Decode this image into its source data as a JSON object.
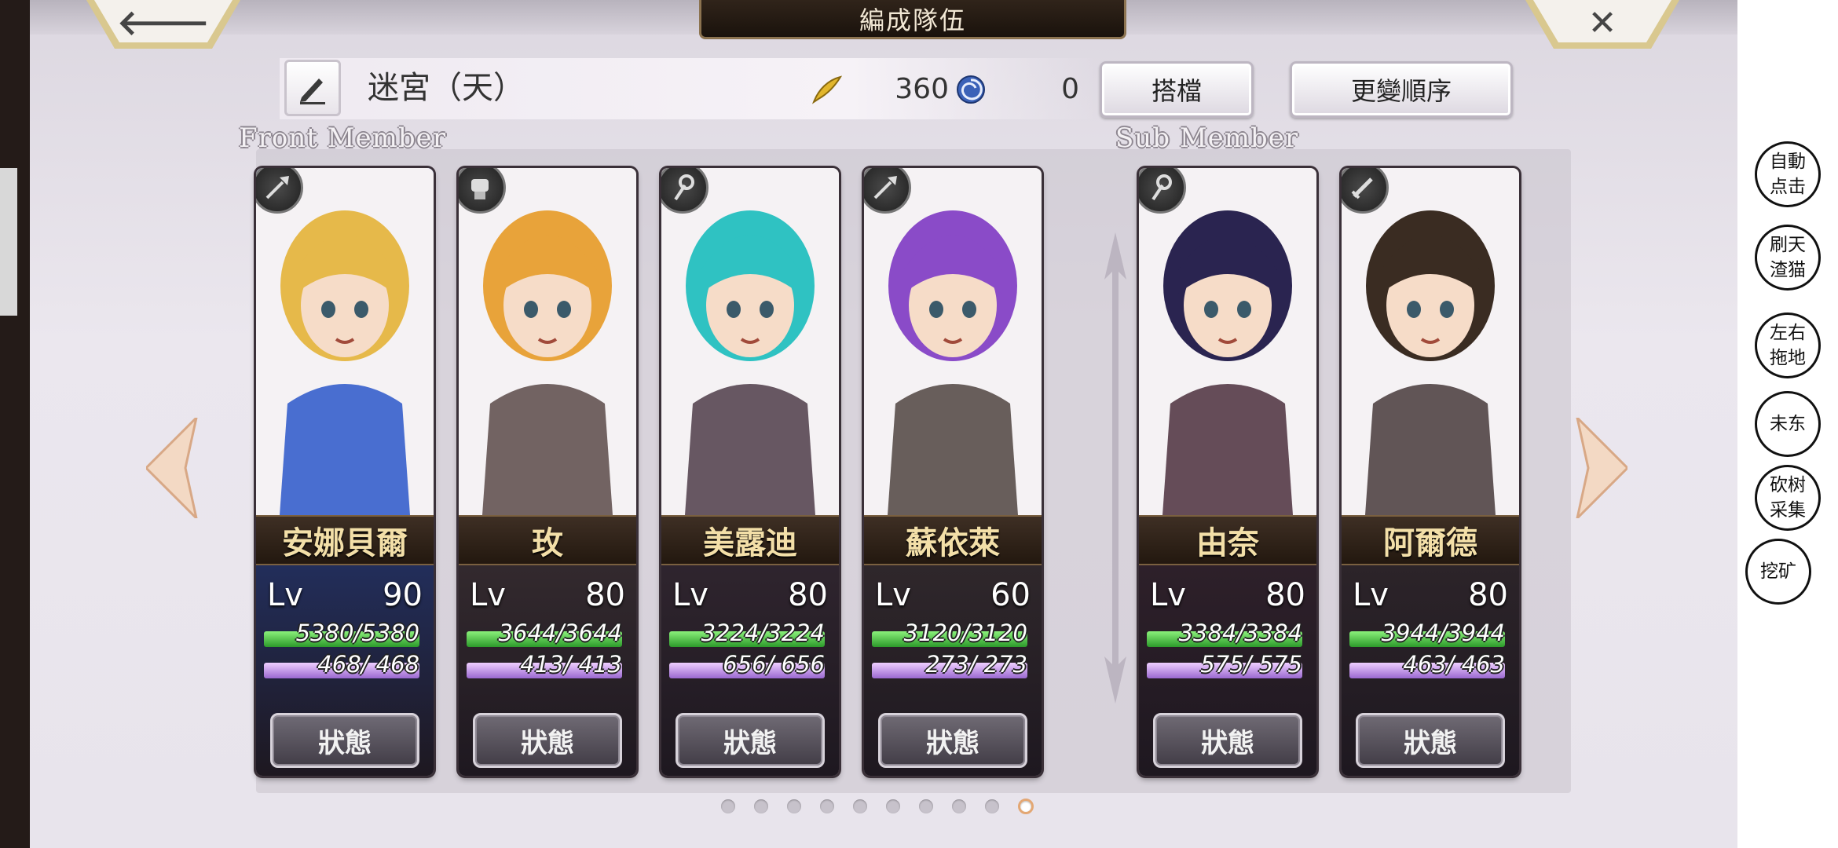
{
  "title": "編成隊伍",
  "back_icon": "arrow-left-icon",
  "close_icon": "close-x-icon",
  "party": {
    "name": "迷宮（天）",
    "edit_icon": "pen-icon",
    "feather_icon": "feather-icon",
    "feather_value": "360",
    "spiral_icon": "spiral-icon",
    "spiral_value": "0"
  },
  "buttons": {
    "partner": "搭檔",
    "reorder": "更變順序"
  },
  "sections": {
    "front": "Front Member",
    "sub": "Sub Member"
  },
  "members": [
    {
      "name": "安娜貝爾",
      "lv_label": "Lv",
      "lv": "90",
      "hp": "5380/5380",
      "mp": "468/ 468",
      "status": "狀態",
      "role_icon": "spear-icon",
      "bg": "#2a57c9",
      "hair": "#e6b94a"
    },
    {
      "name": "玫",
      "lv_label": "Lv",
      "lv": "80",
      "hp": "3644/3644",
      "mp": "413/ 413",
      "status": "狀態",
      "role_icon": "gauntlet-icon",
      "bg": "#5a4a48",
      "hair": "#e8a33a"
    },
    {
      "name": "美露迪",
      "lv_label": "Lv",
      "lv": "80",
      "hp": "3224/3224",
      "mp": "656/ 656",
      "status": "狀態",
      "role_icon": "staff-icon",
      "bg": "#4e3c48",
      "hair": "#2fc2c2"
    },
    {
      "name": "蘇依萊",
      "lv_label": "Lv",
      "lv": "60",
      "hp": "3120/3120",
      "mp": "273/ 273",
      "status": "狀態",
      "role_icon": "spear-icon",
      "bg": "#4f4440",
      "hair": "#8a4bc8"
    },
    {
      "name": "由奈",
      "lv_label": "Lv",
      "lv": "80",
      "hp": "3384/3384",
      "mp": "575/ 575",
      "status": "狀態",
      "role_icon": "staff-icon",
      "bg": "#4b2f3c",
      "hair": "#2a2450"
    },
    {
      "name": "阿爾德",
      "lv_label": "Lv",
      "lv": "80",
      "hp": "3944/3944",
      "mp": "463/ 463",
      "status": "狀態",
      "role_icon": "sword-icon",
      "bg": "#463a3a",
      "hair": "#3a2c22"
    }
  ],
  "pagination": {
    "total": 10,
    "active": 10
  },
  "side_menu": [
    "自動\n点击",
    "刷天\n渣猫",
    "左右\n拖地",
    "未东",
    "砍树\n采集",
    "挖矿"
  ]
}
